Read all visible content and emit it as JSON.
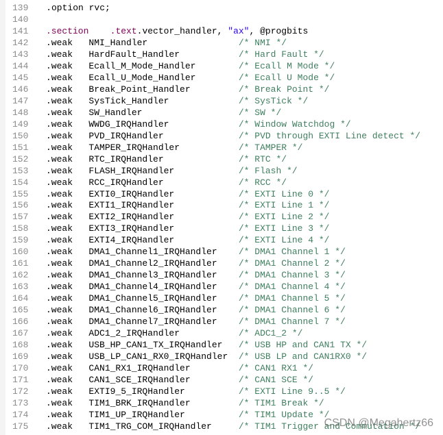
{
  "editor": {
    "colors": {
      "directive": "#7f0055",
      "string": "#2a00ff",
      "comment": "#3f7f5f",
      "line_number": "#8a8a8a"
    },
    "lines": [
      {
        "n": "139",
        "segs": [
          [
            "    .option rvc;",
            ""
          ]
        ]
      },
      {
        "n": "140",
        "segs": []
      },
      {
        "n": "141",
        "segs": [
          [
            ".section",
            "dir"
          ],
          [
            "    ",
            ""
          ],
          [
            ".text",
            "dir"
          ],
          [
            ".vector_handler, ",
            ""
          ],
          [
            "\"ax\"",
            "str"
          ],
          [
            ", @progbits",
            ""
          ]
        ]
      },
      {
        "n": "142",
        "segs": [
          [
            ".weak   NMI_Handler                 ",
            ""
          ],
          [
            "/* NMI */",
            "cm"
          ]
        ]
      },
      {
        "n": "143",
        "segs": [
          [
            ".weak   HardFault_Handler           ",
            ""
          ],
          [
            "/* Hard Fault */",
            "cm"
          ]
        ]
      },
      {
        "n": "144",
        "segs": [
          [
            ".weak   Ecall_M_Mode_Handler        ",
            ""
          ],
          [
            "/* Ecall M Mode */",
            "cm"
          ]
        ]
      },
      {
        "n": "145",
        "segs": [
          [
            ".weak   Ecall_U_Mode_Handler        ",
            ""
          ],
          [
            "/* Ecall U Mode */",
            "cm"
          ]
        ]
      },
      {
        "n": "146",
        "segs": [
          [
            ".weak   Break_Point_Handler         ",
            ""
          ],
          [
            "/* Break Point */",
            "cm"
          ]
        ]
      },
      {
        "n": "147",
        "segs": [
          [
            ".weak   SysTick_Handler             ",
            ""
          ],
          [
            "/* SysTick */",
            "cm"
          ]
        ]
      },
      {
        "n": "148",
        "segs": [
          [
            ".weak   SW_Handler                  ",
            ""
          ],
          [
            "/* SW */",
            "cm"
          ]
        ]
      },
      {
        "n": "149",
        "segs": [
          [
            ".weak   WWDG_IRQHandler             ",
            ""
          ],
          [
            "/* Window Watchdog */",
            "cm"
          ]
        ]
      },
      {
        "n": "150",
        "segs": [
          [
            ".weak   PVD_IRQHandler              ",
            ""
          ],
          [
            "/* PVD through EXTI Line detect */",
            "cm"
          ]
        ]
      },
      {
        "n": "151",
        "segs": [
          [
            ".weak   TAMPER_IRQHandler           ",
            ""
          ],
          [
            "/* TAMPER */",
            "cm"
          ]
        ]
      },
      {
        "n": "152",
        "segs": [
          [
            ".weak   RTC_IRQHandler              ",
            ""
          ],
          [
            "/* RTC */",
            "cm"
          ]
        ]
      },
      {
        "n": "153",
        "segs": [
          [
            ".weak   FLASH_IRQHandler            ",
            ""
          ],
          [
            "/* Flash */",
            "cm"
          ]
        ]
      },
      {
        "n": "154",
        "segs": [
          [
            ".weak   RCC_IRQHandler              ",
            ""
          ],
          [
            "/* RCC */",
            "cm"
          ]
        ]
      },
      {
        "n": "155",
        "segs": [
          [
            ".weak   EXTI0_IRQHandler            ",
            ""
          ],
          [
            "/* EXTI Line 0 */",
            "cm"
          ]
        ]
      },
      {
        "n": "156",
        "segs": [
          [
            ".weak   EXTI1_IRQHandler            ",
            ""
          ],
          [
            "/* EXTI Line 1 */",
            "cm"
          ]
        ]
      },
      {
        "n": "157",
        "segs": [
          [
            ".weak   EXTI2_IRQHandler            ",
            ""
          ],
          [
            "/* EXTI Line 2 */",
            "cm"
          ]
        ]
      },
      {
        "n": "158",
        "segs": [
          [
            ".weak   EXTI3_IRQHandler            ",
            ""
          ],
          [
            "/* EXTI Line 3 */",
            "cm"
          ]
        ]
      },
      {
        "n": "159",
        "segs": [
          [
            ".weak   EXTI4_IRQHandler            ",
            ""
          ],
          [
            "/* EXTI Line 4 */",
            "cm"
          ]
        ]
      },
      {
        "n": "160",
        "segs": [
          [
            ".weak   DMA1_Channel1_IRQHandler    ",
            ""
          ],
          [
            "/* DMA1 Channel 1 */",
            "cm"
          ]
        ]
      },
      {
        "n": "161",
        "segs": [
          [
            ".weak   DMA1_Channel2_IRQHandler    ",
            ""
          ],
          [
            "/* DMA1 Channel 2 */",
            "cm"
          ]
        ]
      },
      {
        "n": "162",
        "segs": [
          [
            ".weak   DMA1_Channel3_IRQHandler    ",
            ""
          ],
          [
            "/* DMA1 Channel 3 */",
            "cm"
          ]
        ]
      },
      {
        "n": "163",
        "segs": [
          [
            ".weak   DMA1_Channel4_IRQHandler    ",
            ""
          ],
          [
            "/* DMA1 Channel 4 */",
            "cm"
          ]
        ]
      },
      {
        "n": "164",
        "segs": [
          [
            ".weak   DMA1_Channel5_IRQHandler    ",
            ""
          ],
          [
            "/* DMA1 Channel 5 */",
            "cm"
          ]
        ]
      },
      {
        "n": "165",
        "segs": [
          [
            ".weak   DMA1_Channel6_IRQHandler    ",
            ""
          ],
          [
            "/* DMA1 Channel 6 */",
            "cm"
          ]
        ]
      },
      {
        "n": "166",
        "segs": [
          [
            ".weak   DMA1_Channel7_IRQHandler    ",
            ""
          ],
          [
            "/* DMA1 Channel 7 */",
            "cm"
          ]
        ]
      },
      {
        "n": "167",
        "segs": [
          [
            ".weak   ADC1_2_IRQHandler           ",
            ""
          ],
          [
            "/* ADC1_2 */",
            "cm"
          ]
        ]
      },
      {
        "n": "168",
        "segs": [
          [
            ".weak   USB_HP_CAN1_TX_IRQHandler   ",
            ""
          ],
          [
            "/* USB HP and CAN1 TX */",
            "cm"
          ]
        ]
      },
      {
        "n": "169",
        "segs": [
          [
            ".weak   USB_LP_CAN1_RX0_IRQHandler  ",
            ""
          ],
          [
            "/* USB LP and CAN1RX0 */",
            "cm"
          ]
        ]
      },
      {
        "n": "170",
        "segs": [
          [
            ".weak   CAN1_RX1_IRQHandler         ",
            ""
          ],
          [
            "/* CAN1 RX1 */",
            "cm"
          ]
        ]
      },
      {
        "n": "171",
        "segs": [
          [
            ".weak   CAN1_SCE_IRQHandler         ",
            ""
          ],
          [
            "/* CAN1 SCE */",
            "cm"
          ]
        ]
      },
      {
        "n": "172",
        "segs": [
          [
            ".weak   EXTI9_5_IRQHandler          ",
            ""
          ],
          [
            "/* EXTI Line 9..5 */",
            "cm"
          ]
        ]
      },
      {
        "n": "173",
        "segs": [
          [
            ".weak   TIM1_BRK_IRQHandler         ",
            ""
          ],
          [
            "/* TIM1 Break */",
            "cm"
          ]
        ]
      },
      {
        "n": "174",
        "segs": [
          [
            ".weak   TIM1_UP_IRQHandler          ",
            ""
          ],
          [
            "/* TIM1 Update */",
            "cm"
          ]
        ]
      },
      {
        "n": "175",
        "segs": [
          [
            ".weak   TIM1_TRG_COM_IRQHandler     ",
            ""
          ],
          [
            "/* TIM1 Trigger and Commutation */",
            "cm"
          ]
        ]
      }
    ]
  },
  "watermark": "CSDN @Megahertz66"
}
